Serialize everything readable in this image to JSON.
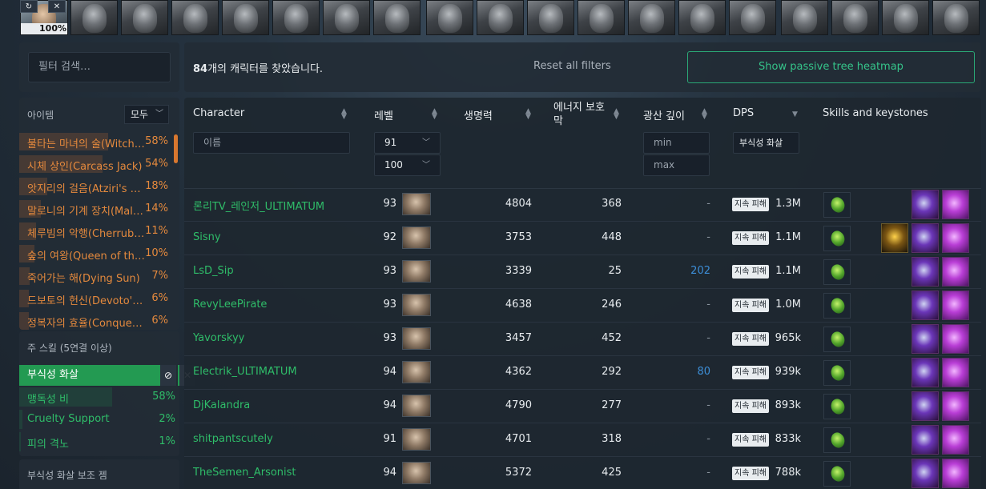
{
  "portrait_strip": {
    "first_percent": "100%",
    "first_btn_icons": [
      "↻",
      "✕"
    ],
    "count": 19
  },
  "sidebar": {
    "search_placeholder": "필터 검색…",
    "items_title": "아이템",
    "items_filter": "모두",
    "items": [
      {
        "name": "불타는 마녀의 술(Witchfire Brew)",
        "value": "58%",
        "percent": 58
      },
      {
        "name": "시체 상인(Carcass Jack)",
        "value": "54%",
        "percent": 54
      },
      {
        "name": "앗지리의 걸음(Atziri's Step)",
        "value": "18%",
        "percent": 18
      },
      {
        "name": "말로니의 기계 장치(Maloney's Mechanism)",
        "value": "14%",
        "percent": 14
      },
      {
        "name": "체루빔의 악행(Cherrubim's Maleficence)",
        "value": "11%",
        "percent": 11
      },
      {
        "name": "숲의 여왕(Queen of the Forest)",
        "value": "10%",
        "percent": 10
      },
      {
        "name": "죽어가는 해(Dying Sun)",
        "value": "7%",
        "percent": 7
      },
      {
        "name": "드보토의 헌신(Devoto's Devotion)",
        "value": "6%",
        "percent": 6
      },
      {
        "name": "정복자의 효율(Conqueror's Efficiency)",
        "value": "6%",
        "percent": 6
      }
    ],
    "skills_title": "주 스킬 (5연결 이상)",
    "skills_selected": "부식성 화살",
    "skills_selected_icons": [
      "⊘",
      "✕"
    ],
    "skills": [
      {
        "name": "맹독성 비",
        "value": "58%",
        "percent": 58
      },
      {
        "name": "Cruelty Support",
        "value": "2%",
        "percent": 2
      },
      {
        "name": "피의 격노",
        "value": "1%",
        "percent": 1
      }
    ],
    "support_title": "부식성 화살 보조 젬"
  },
  "topbar": {
    "found_count": "84",
    "found_text": "개의 캐릭터를 찾았습니다.",
    "reset_label": "Reset all filters",
    "heatmap_label": "Show passive tree heatmap"
  },
  "table": {
    "headers": {
      "character": "Character",
      "level": "레벨",
      "life": "생명력",
      "es": "에너지 보호막",
      "depth": "광산 깊이",
      "dps": "DPS",
      "skills": "Skills and keystones"
    },
    "filters": {
      "name_placeholder": "이름",
      "level_min": "91",
      "level_max": "100",
      "depth_min": "min",
      "depth_max": "max",
      "dps_select": "부식성 화살"
    },
    "dps_tag": "지속 피해",
    "rows": [
      {
        "name": "론리TV_레인저_ULTIMATUM",
        "level": "93",
        "life": "4804",
        "es": "368",
        "depth": "-",
        "dps": "1.3M",
        "keystones": [
          "dark",
          "pink"
        ]
      },
      {
        "name": "Sisny",
        "level": "92",
        "life": "3753",
        "es": "448",
        "depth": "-",
        "dps": "1.1M",
        "keystones": [
          "gold",
          "dark",
          "pink"
        ]
      },
      {
        "name": "LsD_Sip",
        "level": "93",
        "life": "3339",
        "es": "25",
        "depth": "202",
        "dps": "1.1M",
        "keystones": [
          "dark",
          "pink"
        ]
      },
      {
        "name": "RevyLeePirate",
        "level": "93",
        "life": "4638",
        "es": "246",
        "depth": "-",
        "dps": "1.0M",
        "keystones": [
          "dark",
          "pink"
        ]
      },
      {
        "name": "Yavorskyy",
        "level": "93",
        "life": "3457",
        "es": "452",
        "depth": "-",
        "dps": "965k",
        "keystones": [
          "dark",
          "pink"
        ]
      },
      {
        "name": "Electrik_ULTIMATUM",
        "level": "94",
        "life": "4362",
        "es": "292",
        "depth": "80",
        "dps": "939k",
        "keystones": [
          "dark",
          "pink"
        ]
      },
      {
        "name": "DjKalandra",
        "level": "94",
        "life": "4790",
        "es": "277",
        "depth": "-",
        "dps": "893k",
        "keystones": [
          "dark",
          "pink"
        ]
      },
      {
        "name": "shitpantscutely",
        "level": "91",
        "life": "4701",
        "es": "318",
        "depth": "-",
        "dps": "833k",
        "keystones": [
          "dark",
          "pink"
        ]
      },
      {
        "name": "TheSemen_Arsonist",
        "level": "94",
        "life": "5372",
        "es": "425",
        "depth": "-",
        "dps": "788k",
        "keystones": [
          "dark",
          "pink"
        ]
      }
    ]
  },
  "colors": {
    "accent_green": "#2fbd69",
    "item_orange": "#e4893d",
    "depth_blue": "#3d8fd8",
    "heatmap_teal": "#35c48a"
  }
}
